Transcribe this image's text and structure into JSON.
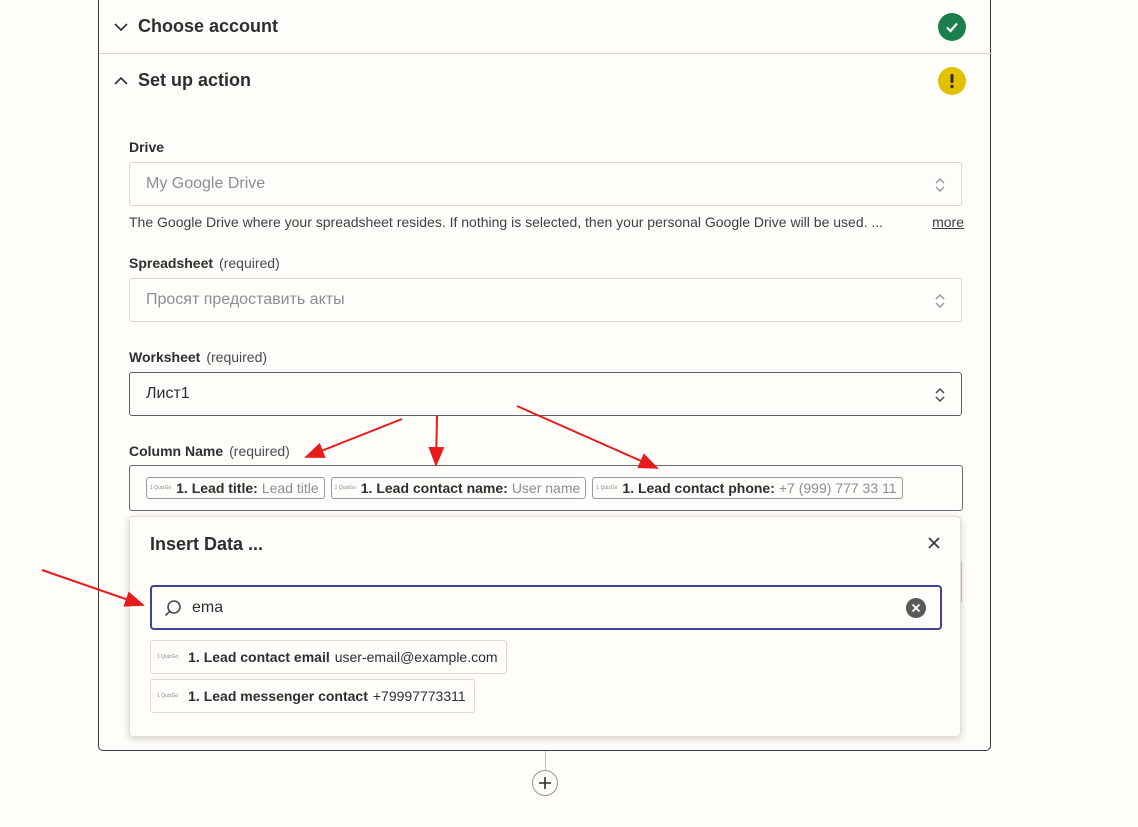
{
  "sections": {
    "choose_account": {
      "title": "Choose account",
      "status": "complete"
    },
    "setup_action": {
      "title": "Set up action",
      "status": "warning"
    }
  },
  "fields": {
    "drive": {
      "label": "Drive",
      "value": "My Google Drive",
      "help": "The Google Drive where your spreadsheet resides. If nothing is selected, then your personal Google Drive will be used. ...",
      "more": "more"
    },
    "spreadsheet": {
      "label": "Spreadsheet",
      "required": "(required)",
      "value": "Просят предоставить акты"
    },
    "worksheet": {
      "label": "Worksheet",
      "required": "(required)",
      "value": "Лист1"
    },
    "column_name": {
      "label": "Column Name",
      "required": "(required)",
      "pills": [
        {
          "logo": "1 QuizGo",
          "key": "1. Lead title:",
          "value": "Lead title"
        },
        {
          "logo": "1 QuizGo",
          "key": "1. Lead contact name:",
          "value": "User name"
        },
        {
          "logo": "1 QuizGo",
          "key": "1. Lead contact phone:",
          "value": "+7 (999) 777 33 11"
        }
      ]
    }
  },
  "insert_data": {
    "title": "Insert Data ...",
    "search_value": "ema",
    "results": [
      {
        "logo": "1 QuizGo",
        "key": "1. Lead contact email",
        "value": "user-email@example.com"
      },
      {
        "logo": "1 QuizGo",
        "key": "1. Lead messenger contact",
        "value": "+79997773311"
      }
    ]
  },
  "colors": {
    "success": "#1a7f4b",
    "warning": "#e3c000",
    "focus": "#3d4592",
    "annotation_arrow": "#e81b1b"
  }
}
